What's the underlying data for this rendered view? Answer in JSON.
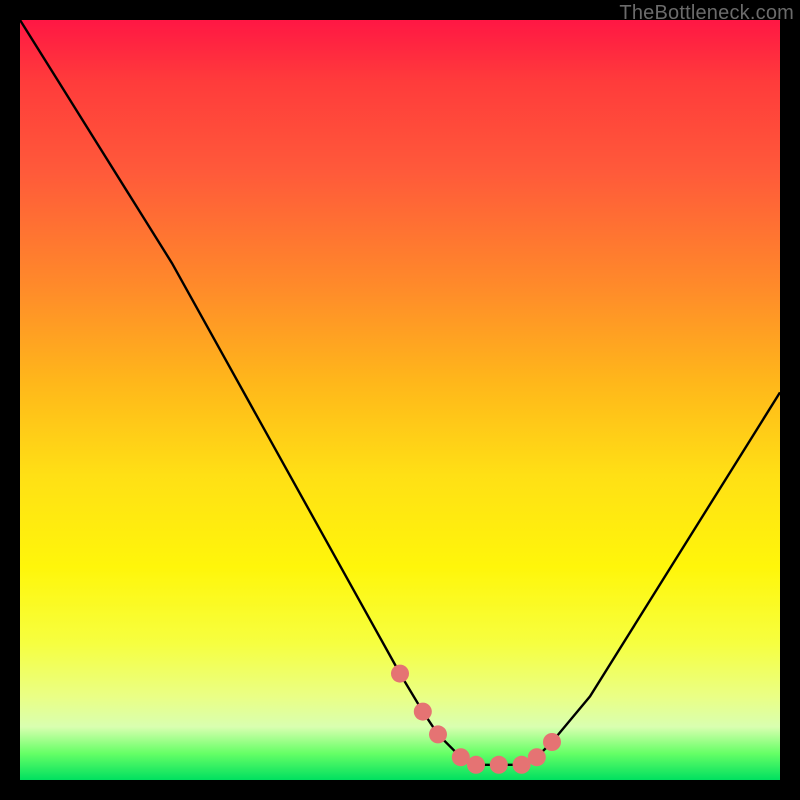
{
  "watermark": "TheBottleneck.com",
  "colors": {
    "page_bg": "#000000",
    "curve_stroke": "#000000",
    "marker_fill": "#e57373",
    "gradient_top": "#ff1744",
    "gradient_mid": "#ffe015",
    "gradient_bottom": "#00e060"
  },
  "chart_data": {
    "type": "line",
    "title": "",
    "xlabel": "",
    "ylabel": "",
    "xlim": [
      0,
      100
    ],
    "ylim": [
      0,
      100
    ],
    "series": [
      {
        "name": "bottleneck-curve",
        "x": [
          0,
          5,
          10,
          15,
          20,
          25,
          30,
          35,
          40,
          45,
          50,
          53,
          55,
          58,
          60,
          63,
          66,
          68,
          70,
          75,
          80,
          85,
          90,
          95,
          100
        ],
        "values": [
          100,
          92,
          84,
          76,
          68,
          59,
          50,
          41,
          32,
          23,
          14,
          9,
          6,
          3,
          2,
          2,
          2,
          3,
          5,
          11,
          19,
          27,
          35,
          43,
          51
        ]
      }
    ],
    "markers": {
      "name": "fit-highlight",
      "x": [
        50,
        53,
        55,
        58,
        60,
        63,
        66,
        68,
        70
      ],
      "values": [
        14,
        9,
        6,
        3,
        2,
        2,
        2,
        3,
        5
      ]
    },
    "annotations": []
  }
}
